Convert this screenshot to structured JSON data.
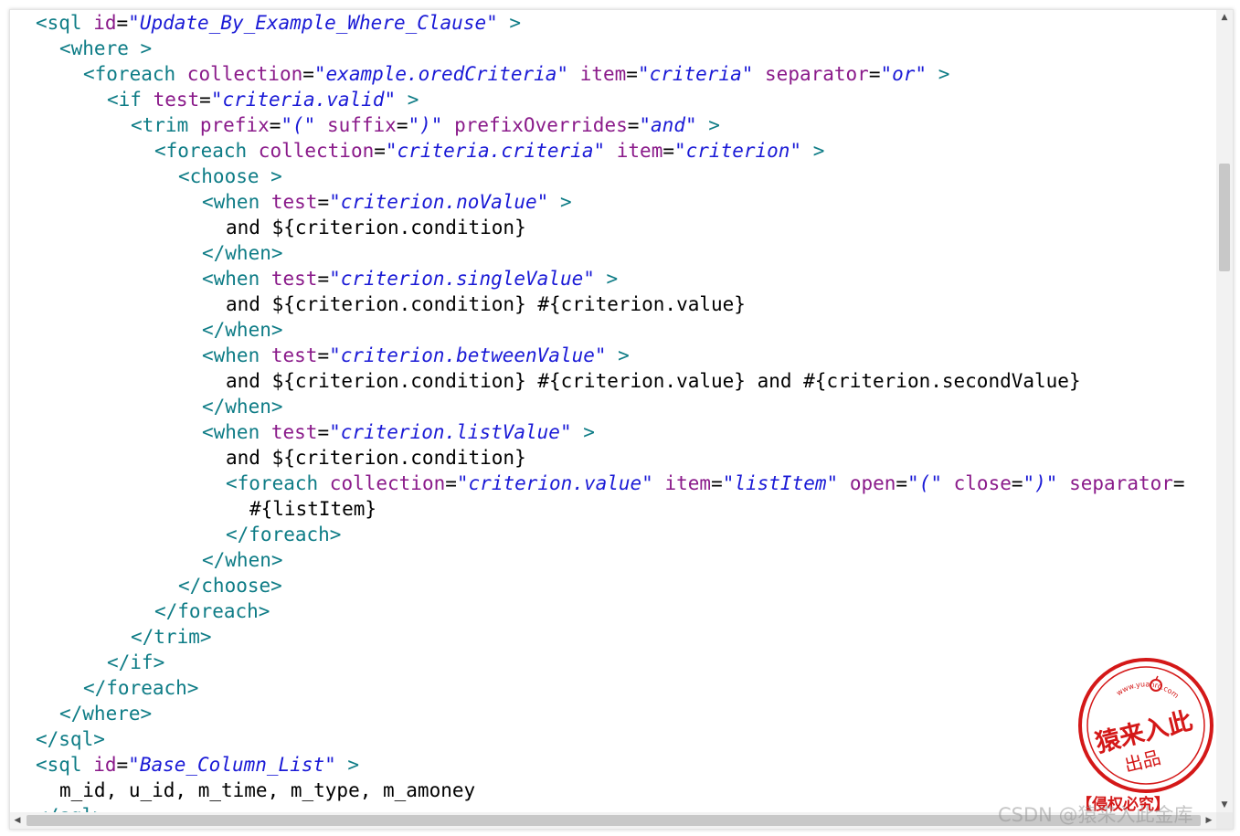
{
  "code_lines": [
    {
      "indent": 0,
      "segments": [
        {
          "c": "tag",
          "t": "<sql "
        },
        {
          "c": "attr",
          "t": "id"
        },
        {
          "c": "txt",
          "t": "="
        },
        {
          "c": "val",
          "t": "\"Update_By_Example_Where_Clause\""
        },
        {
          "c": "tag",
          "t": " >"
        }
      ]
    },
    {
      "indent": 1,
      "segments": [
        {
          "c": "tag",
          "t": "<where >"
        }
      ]
    },
    {
      "indent": 2,
      "segments": [
        {
          "c": "tag",
          "t": "<foreach "
        },
        {
          "c": "attr",
          "t": "collection"
        },
        {
          "c": "txt",
          "t": "="
        },
        {
          "c": "val",
          "t": "\"example.oredCriteria\""
        },
        {
          "c": "txt",
          "t": " "
        },
        {
          "c": "attr",
          "t": "item"
        },
        {
          "c": "txt",
          "t": "="
        },
        {
          "c": "val",
          "t": "\"criteria\""
        },
        {
          "c": "txt",
          "t": " "
        },
        {
          "c": "attr",
          "t": "separator"
        },
        {
          "c": "txt",
          "t": "="
        },
        {
          "c": "val",
          "t": "\"or\""
        },
        {
          "c": "tag",
          "t": " >"
        }
      ]
    },
    {
      "indent": 3,
      "segments": [
        {
          "c": "tag",
          "t": "<if "
        },
        {
          "c": "attr",
          "t": "test"
        },
        {
          "c": "txt",
          "t": "="
        },
        {
          "c": "val",
          "t": "\"criteria.valid\""
        },
        {
          "c": "tag",
          "t": " >"
        }
      ]
    },
    {
      "indent": 4,
      "segments": [
        {
          "c": "tag",
          "t": "<trim "
        },
        {
          "c": "attr",
          "t": "prefix"
        },
        {
          "c": "txt",
          "t": "="
        },
        {
          "c": "val",
          "t": "\"(\""
        },
        {
          "c": "txt",
          "t": " "
        },
        {
          "c": "attr",
          "t": "suffix"
        },
        {
          "c": "txt",
          "t": "="
        },
        {
          "c": "val",
          "t": "\")\""
        },
        {
          "c": "txt",
          "t": " "
        },
        {
          "c": "attr",
          "t": "prefixOverrides"
        },
        {
          "c": "txt",
          "t": "="
        },
        {
          "c": "val",
          "t": "\"and\""
        },
        {
          "c": "tag",
          "t": " >"
        }
      ]
    },
    {
      "indent": 5,
      "segments": [
        {
          "c": "tag",
          "t": "<foreach "
        },
        {
          "c": "attr",
          "t": "collection"
        },
        {
          "c": "txt",
          "t": "="
        },
        {
          "c": "val",
          "t": "\"criteria.criteria\""
        },
        {
          "c": "txt",
          "t": " "
        },
        {
          "c": "attr",
          "t": "item"
        },
        {
          "c": "txt",
          "t": "="
        },
        {
          "c": "val",
          "t": "\"criterion\""
        },
        {
          "c": "tag",
          "t": " >"
        }
      ]
    },
    {
      "indent": 6,
      "segments": [
        {
          "c": "tag",
          "t": "<choose >"
        }
      ]
    },
    {
      "indent": 7,
      "segments": [
        {
          "c": "tag",
          "t": "<when "
        },
        {
          "c": "attr",
          "t": "test"
        },
        {
          "c": "txt",
          "t": "="
        },
        {
          "c": "val",
          "t": "\"criterion.noValue\""
        },
        {
          "c": "tag",
          "t": " >"
        }
      ]
    },
    {
      "indent": 8,
      "segments": [
        {
          "c": "txt",
          "t": "and ${criterion.condition}"
        }
      ]
    },
    {
      "indent": 7,
      "segments": [
        {
          "c": "tag",
          "t": "</when>"
        }
      ]
    },
    {
      "indent": 7,
      "segments": [
        {
          "c": "tag",
          "t": "<when "
        },
        {
          "c": "attr",
          "t": "test"
        },
        {
          "c": "txt",
          "t": "="
        },
        {
          "c": "val",
          "t": "\"criterion.singleValue\""
        },
        {
          "c": "tag",
          "t": " >"
        }
      ]
    },
    {
      "indent": 8,
      "segments": [
        {
          "c": "txt",
          "t": "and ${criterion.condition} #{criterion.value}"
        }
      ]
    },
    {
      "indent": 7,
      "segments": [
        {
          "c": "tag",
          "t": "</when>"
        }
      ]
    },
    {
      "indent": 7,
      "segments": [
        {
          "c": "tag",
          "t": "<when "
        },
        {
          "c": "attr",
          "t": "test"
        },
        {
          "c": "txt",
          "t": "="
        },
        {
          "c": "val",
          "t": "\"criterion.betweenValue\""
        },
        {
          "c": "tag",
          "t": " >"
        }
      ]
    },
    {
      "indent": 8,
      "segments": [
        {
          "c": "txt",
          "t": "and ${criterion.condition} #{criterion.value} and #{criterion.secondValue}"
        }
      ]
    },
    {
      "indent": 7,
      "segments": [
        {
          "c": "tag",
          "t": "</when>"
        }
      ]
    },
    {
      "indent": 7,
      "segments": [
        {
          "c": "tag",
          "t": "<when "
        },
        {
          "c": "attr",
          "t": "test"
        },
        {
          "c": "txt",
          "t": "="
        },
        {
          "c": "val",
          "t": "\"criterion.listValue\""
        },
        {
          "c": "tag",
          "t": " >"
        }
      ]
    },
    {
      "indent": 8,
      "segments": [
        {
          "c": "txt",
          "t": "and ${criterion.condition}"
        }
      ]
    },
    {
      "indent": 8,
      "segments": [
        {
          "c": "tag",
          "t": "<foreach "
        },
        {
          "c": "attr",
          "t": "collection"
        },
        {
          "c": "txt",
          "t": "="
        },
        {
          "c": "val",
          "t": "\"criterion.value\""
        },
        {
          "c": "txt",
          "t": " "
        },
        {
          "c": "attr",
          "t": "item"
        },
        {
          "c": "txt",
          "t": "="
        },
        {
          "c": "val",
          "t": "\"listItem\""
        },
        {
          "c": "txt",
          "t": " "
        },
        {
          "c": "attr",
          "t": "open"
        },
        {
          "c": "txt",
          "t": "="
        },
        {
          "c": "val",
          "t": "\"(\""
        },
        {
          "c": "txt",
          "t": " "
        },
        {
          "c": "attr",
          "t": "close"
        },
        {
          "c": "txt",
          "t": "="
        },
        {
          "c": "val",
          "t": "\")\""
        },
        {
          "c": "txt",
          "t": " "
        },
        {
          "c": "attr",
          "t": "separator"
        },
        {
          "c": "txt",
          "t": "="
        }
      ]
    },
    {
      "indent": 9,
      "segments": [
        {
          "c": "txt",
          "t": "#{listItem}"
        }
      ]
    },
    {
      "indent": 8,
      "segments": [
        {
          "c": "tag",
          "t": "</foreach>"
        }
      ]
    },
    {
      "indent": 7,
      "segments": [
        {
          "c": "tag",
          "t": "</when>"
        }
      ]
    },
    {
      "indent": 6,
      "segments": [
        {
          "c": "tag",
          "t": "</choose>"
        }
      ]
    },
    {
      "indent": 5,
      "segments": [
        {
          "c": "tag",
          "t": "</foreach>"
        }
      ]
    },
    {
      "indent": 4,
      "segments": [
        {
          "c": "tag",
          "t": "</trim>"
        }
      ]
    },
    {
      "indent": 3,
      "segments": [
        {
          "c": "tag",
          "t": "</if>"
        }
      ]
    },
    {
      "indent": 2,
      "segments": [
        {
          "c": "tag",
          "t": "</foreach>"
        }
      ]
    },
    {
      "indent": 1,
      "segments": [
        {
          "c": "tag",
          "t": "</where>"
        }
      ]
    },
    {
      "indent": 0,
      "segments": [
        {
          "c": "tag",
          "t": "</sql>"
        }
      ]
    },
    {
      "indent": 0,
      "segments": [
        {
          "c": "tag",
          "t": "<sql "
        },
        {
          "c": "attr",
          "t": "id"
        },
        {
          "c": "txt",
          "t": "="
        },
        {
          "c": "val",
          "t": "\"Base_Column_List\""
        },
        {
          "c": "tag",
          "t": " >"
        }
      ]
    },
    {
      "indent": 1,
      "segments": [
        {
          "c": "txt",
          "t": "m_id, u_id, m_time, m_type, m_amoney"
        }
      ]
    },
    {
      "indent": 0,
      "segments": [
        {
          "c": "tag",
          "t": "</sql>"
        }
      ]
    }
  ],
  "colors": {
    "tag": "#0e7c86",
    "attribute": "#8a1a8a",
    "value": "#1a1ad6",
    "text": "#000000",
    "stamp": "#d41818"
  },
  "scrollbars": {
    "up_arrow": "▲",
    "down_arrow": "▼",
    "left_arrow": "◀",
    "right_arrow": "▶",
    "vertical_position": 0.19,
    "horizontal_position": 0.0
  },
  "stamp": {
    "url": "www.yuanrc.com",
    "name": "猿来入此",
    "sub": "出品",
    "caption": "【侵权必究】"
  },
  "watermark": "CSDN @猿来入此金库"
}
